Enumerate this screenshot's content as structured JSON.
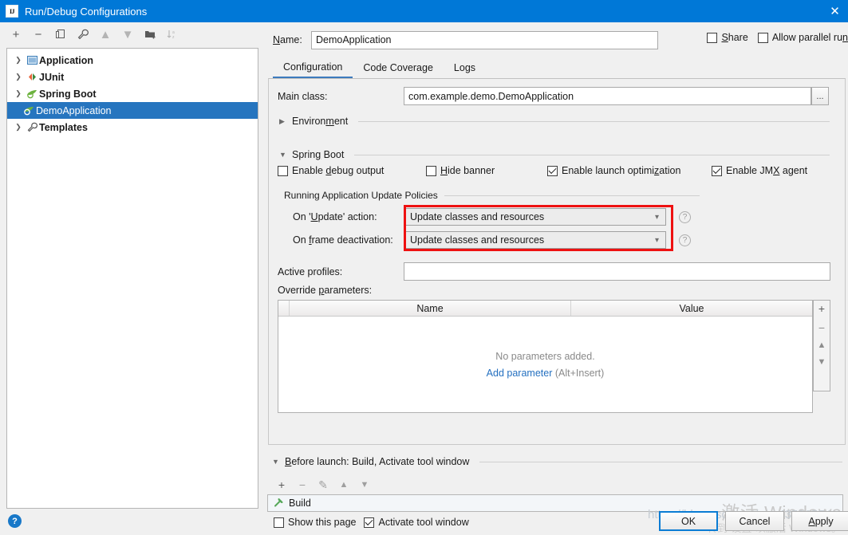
{
  "window": {
    "title": "Run/Debug Configurations",
    "logo_text": "IJ",
    "close_icon": "close-icon",
    "accent_color": "#0078d7"
  },
  "left_toolbar": {
    "buttons": [
      {
        "name": "add-configuration-button",
        "icon": "plus-icon",
        "glyph": "+",
        "enabled": true
      },
      {
        "name": "remove-configuration-button",
        "icon": "minus-icon",
        "glyph": "−",
        "enabled": true
      },
      {
        "name": "copy-configuration-button",
        "icon": "copy-icon",
        "glyph": "❐",
        "enabled": true
      },
      {
        "name": "edit-templates-button",
        "icon": "wrench-icon",
        "glyph": "🔧",
        "enabled": true
      },
      {
        "name": "move-up-button",
        "icon": "triangle-up-icon",
        "glyph": "▲",
        "enabled": false
      },
      {
        "name": "move-down-button",
        "icon": "triangle-down-icon",
        "glyph": "▼",
        "enabled": false
      },
      {
        "name": "move-into-folder-button",
        "icon": "folder-add-icon",
        "glyph": "🗀",
        "enabled": true
      },
      {
        "name": "sort-configurations-button",
        "icon": "sort-az-icon",
        "glyph": "↧",
        "enabled": false
      }
    ]
  },
  "tree": {
    "items": [
      {
        "label": "Application",
        "icon": "application-icon",
        "expandable": true,
        "expanded": false,
        "selected": false,
        "child": false
      },
      {
        "label": "JUnit",
        "icon": "junit-icon",
        "expandable": true,
        "expanded": false,
        "selected": false,
        "child": false
      },
      {
        "label": "Spring Boot",
        "icon": "spring-boot-icon",
        "expandable": true,
        "expanded": true,
        "selected": false,
        "child": false
      },
      {
        "label": "DemoApplication",
        "icon": "spring-boot-icon",
        "expandable": false,
        "expanded": false,
        "selected": true,
        "child": true
      },
      {
        "label": "Templates",
        "icon": "wrench-icon",
        "expandable": true,
        "expanded": false,
        "selected": false,
        "child": false
      }
    ]
  },
  "help_button": {
    "name": "help-button",
    "glyph": "?"
  },
  "header": {
    "name_label": "Name:",
    "name_label_mnemonic": "N",
    "name_value": "DemoApplication",
    "share": {
      "label": "Share",
      "mnemonic": "S",
      "checked": false
    },
    "allow_parallel_run": {
      "label": "Allow parallel run",
      "mnemonic": "n",
      "checked": false
    }
  },
  "tabs": [
    {
      "label": "Configuration",
      "active": true
    },
    {
      "label": "Code Coverage",
      "active": false
    },
    {
      "label": "Logs",
      "active": false
    }
  ],
  "configuration": {
    "main_class": {
      "label": "Main class:",
      "value": "com.example.demo.DemoApplication",
      "browse_button": "..."
    },
    "environment_section": {
      "label": "Environment",
      "mnemonic": "m",
      "expanded": false
    },
    "spring_boot_section": {
      "label": "Spring Boot",
      "mnemonic": "g",
      "expanded": true
    },
    "spring_boot_checkboxes": [
      {
        "label": "Enable debug output",
        "mnemonic": "d",
        "checked": false
      },
      {
        "label": "Hide banner",
        "mnemonic": "H",
        "checked": false
      },
      {
        "label": "Enable launch optimization",
        "mnemonic": "z",
        "checked": true
      },
      {
        "label": "Enable JMX agent",
        "mnemonic": "X",
        "checked": true
      }
    ],
    "update_policies": {
      "group_label": "Running Application Update Policies",
      "on_update_action": {
        "label": "On 'Update' action:",
        "mnemonic": "U",
        "value": "Update classes and resources",
        "help_icon": "question-icon"
      },
      "on_frame_deactivation": {
        "label": "On frame deactivation:",
        "mnemonic": "f",
        "value": "Update classes and resources",
        "help_icon": "question-icon"
      },
      "highlight_color": "#ee1111"
    },
    "active_profiles": {
      "label": "Active profiles:",
      "value": "",
      "placeholder": ""
    },
    "override_parameters": {
      "label": "Override parameters:",
      "mnemonic": "p",
      "columns": [
        "",
        "Name",
        "Value"
      ],
      "rows": [],
      "empty_text": "No parameters added.",
      "empty_link": "Add parameter",
      "empty_link_shortcut": "(Alt+Insert)",
      "side_buttons": [
        {
          "name": "add-parameter-button",
          "icon": "plus-icon",
          "glyph": "+",
          "enabled": true
        },
        {
          "name": "remove-parameter-button",
          "icon": "minus-icon",
          "glyph": "−",
          "enabled": false
        },
        {
          "name": "move-parameter-up-button",
          "icon": "triangle-up-icon",
          "glyph": "▲",
          "enabled": false
        },
        {
          "name": "move-parameter-down-button",
          "icon": "triangle-down-icon",
          "glyph": "▼",
          "enabled": false
        }
      ]
    }
  },
  "before_launch": {
    "header": "Before launch: Build, Activate tool window",
    "mnemonic": "B",
    "expanded": true,
    "toolbar": [
      {
        "name": "add-task-button",
        "icon": "plus-icon",
        "glyph": "+",
        "enabled": true
      },
      {
        "name": "remove-task-button",
        "icon": "minus-icon",
        "glyph": "−",
        "enabled": false
      },
      {
        "name": "edit-task-button",
        "icon": "pencil-icon",
        "glyph": "✎",
        "enabled": false
      },
      {
        "name": "move-task-up-button",
        "icon": "triangle-up-icon",
        "glyph": "▲",
        "enabled": false
      },
      {
        "name": "move-task-down-button",
        "icon": "triangle-down-icon",
        "glyph": "▼",
        "enabled": false
      }
    ],
    "tasks": [
      {
        "label": "Build",
        "icon": "build-hammer-icon",
        "icon_color": "#57a85a"
      }
    ],
    "bottom_checkboxes": [
      {
        "label": "Show this page",
        "checked": false
      },
      {
        "label": "Activate tool window",
        "checked": true
      }
    ]
  },
  "dialog_buttons": [
    {
      "label": "OK",
      "name": "ok-button",
      "default": true,
      "mnemonic": ""
    },
    {
      "label": "Cancel",
      "name": "cancel-button",
      "default": false,
      "mnemonic": ""
    },
    {
      "label": "Apply",
      "name": "apply-button",
      "default": false,
      "mnemonic": "A"
    }
  ],
  "watermarks": {
    "windows_activate_line1": "激活 Windows",
    "windows_activate_line2": "转到“设置”以激活 Windows。",
    "blog_url": "https://blog.csdn.net/qq_43500554"
  }
}
